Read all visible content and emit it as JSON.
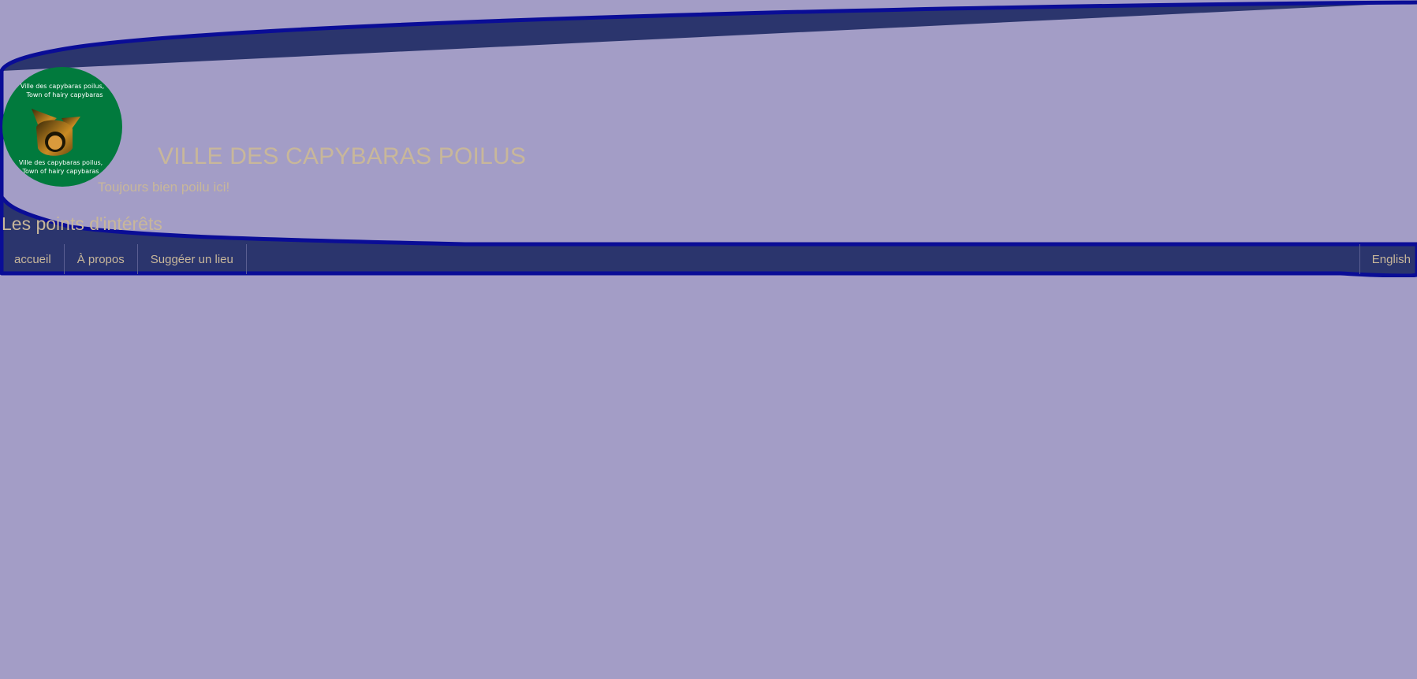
{
  "header": {
    "site_title": "VILLE DES CAPYBARAS POILUS",
    "tagline": "Toujours bien poilu ici!",
    "section_heading": "Les points d'intérêts"
  },
  "logo": {
    "caption_top_line1": "Ville des capybaras poilus,",
    "caption_top_line2": "Town of hairy capybaras",
    "caption_bottom_line1": "Ville des capybaras poilus,",
    "caption_bottom_line2": "Town of hairy capybaras",
    "icon": "capybara-emblem-icon"
  },
  "nav": {
    "items": [
      {
        "label": "accueil"
      },
      {
        "label": "À propos"
      },
      {
        "label": "Suggéer un lieu"
      }
    ],
    "language_label": "English"
  },
  "colors": {
    "page_background": "#a39dc6",
    "banner_fill": "#2b356d",
    "banner_border": "#0a0d96",
    "text_tan": "#c8b79a",
    "logo_green": "#017a3d",
    "emblem_gold": "#c98b23"
  }
}
